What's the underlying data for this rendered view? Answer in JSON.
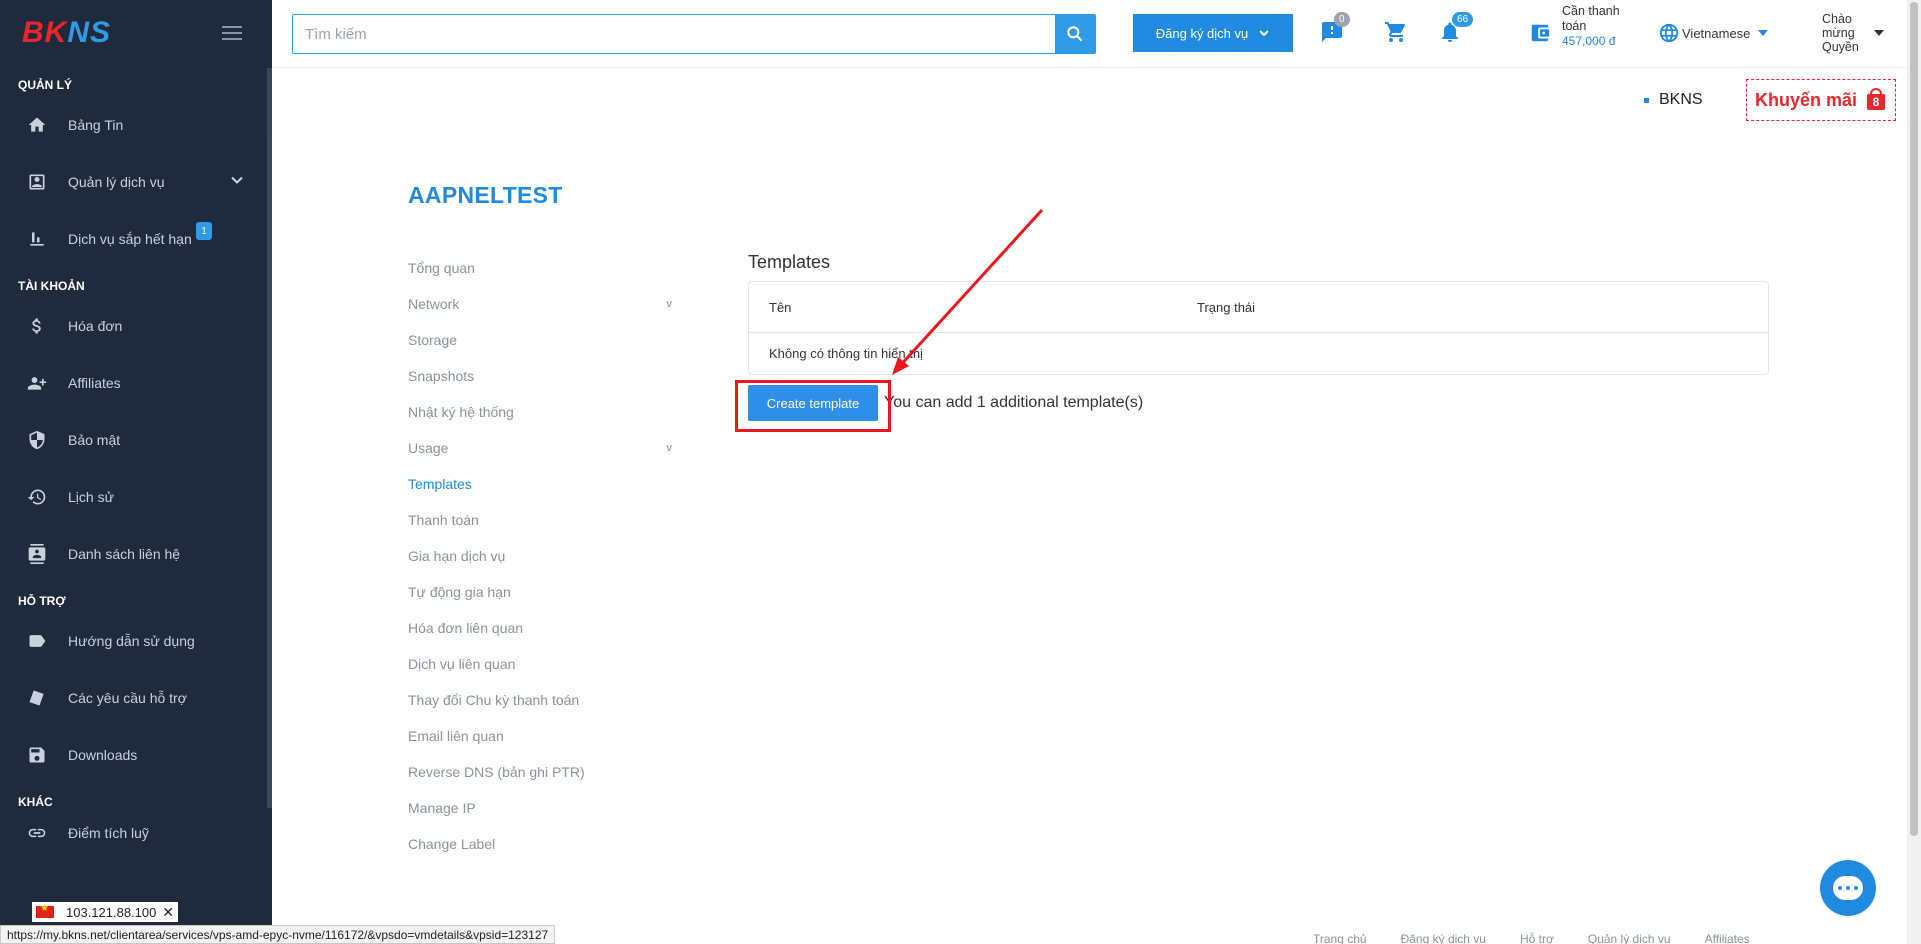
{
  "brand": {
    "logo_text_red": "BK",
    "logo_text_blue": "NS"
  },
  "sidebar": {
    "sections": [
      {
        "title": "QUẢN LÝ",
        "items": [
          {
            "label": "Bảng Tin",
            "icon": "home-icon"
          },
          {
            "label": "Quản lý dịch vụ",
            "icon": "account-box-icon",
            "expandable": true
          },
          {
            "label": "Dịch vụ sắp hết hạn",
            "icon": "bar-chart-icon",
            "badge": "1"
          }
        ]
      },
      {
        "title": "TÀI KHOẢN",
        "items": [
          {
            "label": "Hóa đơn",
            "icon": "dollar-icon"
          },
          {
            "label": "Affiliates",
            "icon": "group-add-icon"
          },
          {
            "label": "Bảo mật",
            "icon": "shield-icon"
          },
          {
            "label": "Lịch sử",
            "icon": "history-icon"
          },
          {
            "label": "Danh sách liên hệ",
            "icon": "contacts-icon"
          }
        ]
      },
      {
        "title": "HỖ TRỢ",
        "items": [
          {
            "label": "Hướng dẫn sử dụng",
            "icon": "label-icon"
          },
          {
            "label": "Các yêu cầu hỗ trợ",
            "icon": "ticket-icon"
          },
          {
            "label": "Downloads",
            "icon": "save-icon"
          }
        ]
      },
      {
        "title": "KHÁC",
        "items": [
          {
            "label": "Điểm tích luỹ",
            "icon": "link-icon"
          }
        ]
      }
    ]
  },
  "topbar": {
    "search_placeholder": "Tìm kiếm",
    "register_label": "Đăng ký dịch vụ",
    "messages_badge": "0",
    "notifications_badge": "66",
    "wallet_label": "Cần thanh toán",
    "wallet_amount": "457,000 đ",
    "language": "Vietnamese",
    "user_greeting": "Chào mừng Quyền"
  },
  "subbar": {
    "ticker_text": "BKNS",
    "promo_label": "Khuyến mãi",
    "promo_count": "8"
  },
  "page": {
    "title": "AAPNELTEST",
    "nav": [
      {
        "label": "Tổng quan"
      },
      {
        "label": "Network",
        "expand": "v"
      },
      {
        "label": "Storage"
      },
      {
        "label": "Snapshots"
      },
      {
        "label": "Nhật ký hệ thống"
      },
      {
        "label": "Usage",
        "expand": "v"
      },
      {
        "label": "Templates",
        "active": true
      },
      {
        "label": "Thanh toán"
      },
      {
        "label": "Gia hạn dịch vụ"
      },
      {
        "label": "Tự động gia hạn"
      },
      {
        "label": "Hóa đơn liên quan"
      },
      {
        "label": "Dịch vụ liên quan"
      },
      {
        "label": "Thay đổi Chu kỳ thanh toán"
      },
      {
        "label": "Email liên quan"
      },
      {
        "label": "Reverse DNS (bản ghi PTR)"
      },
      {
        "label": "Manage IP"
      },
      {
        "label": "Change Label"
      }
    ],
    "section_title": "Templates",
    "table": {
      "columns": [
        "Tên",
        "Trạng thái"
      ],
      "empty_text": "Không có thông tin hiển thị"
    },
    "create_button": "Create template",
    "create_note": "You can add 1 additional template(s)"
  },
  "footer": {
    "links": [
      "Trang chủ",
      "Đăng ký dịch vụ",
      "Hỗ trợ",
      "Quản lý dịch vụ",
      "Affiliates"
    ]
  },
  "overlay": {
    "ip_chip": "103.121.88.100",
    "status_url": "https://my.bkns.net/clientarea/services/vps-amd-epyc-nvme/116172/&vpsdo=vmdetails&vpsid=123127"
  },
  "colors": {
    "accent": "#1f8ae0",
    "sidebar_bg": "#1f2a3c",
    "annotation_red": "#e8181e"
  }
}
